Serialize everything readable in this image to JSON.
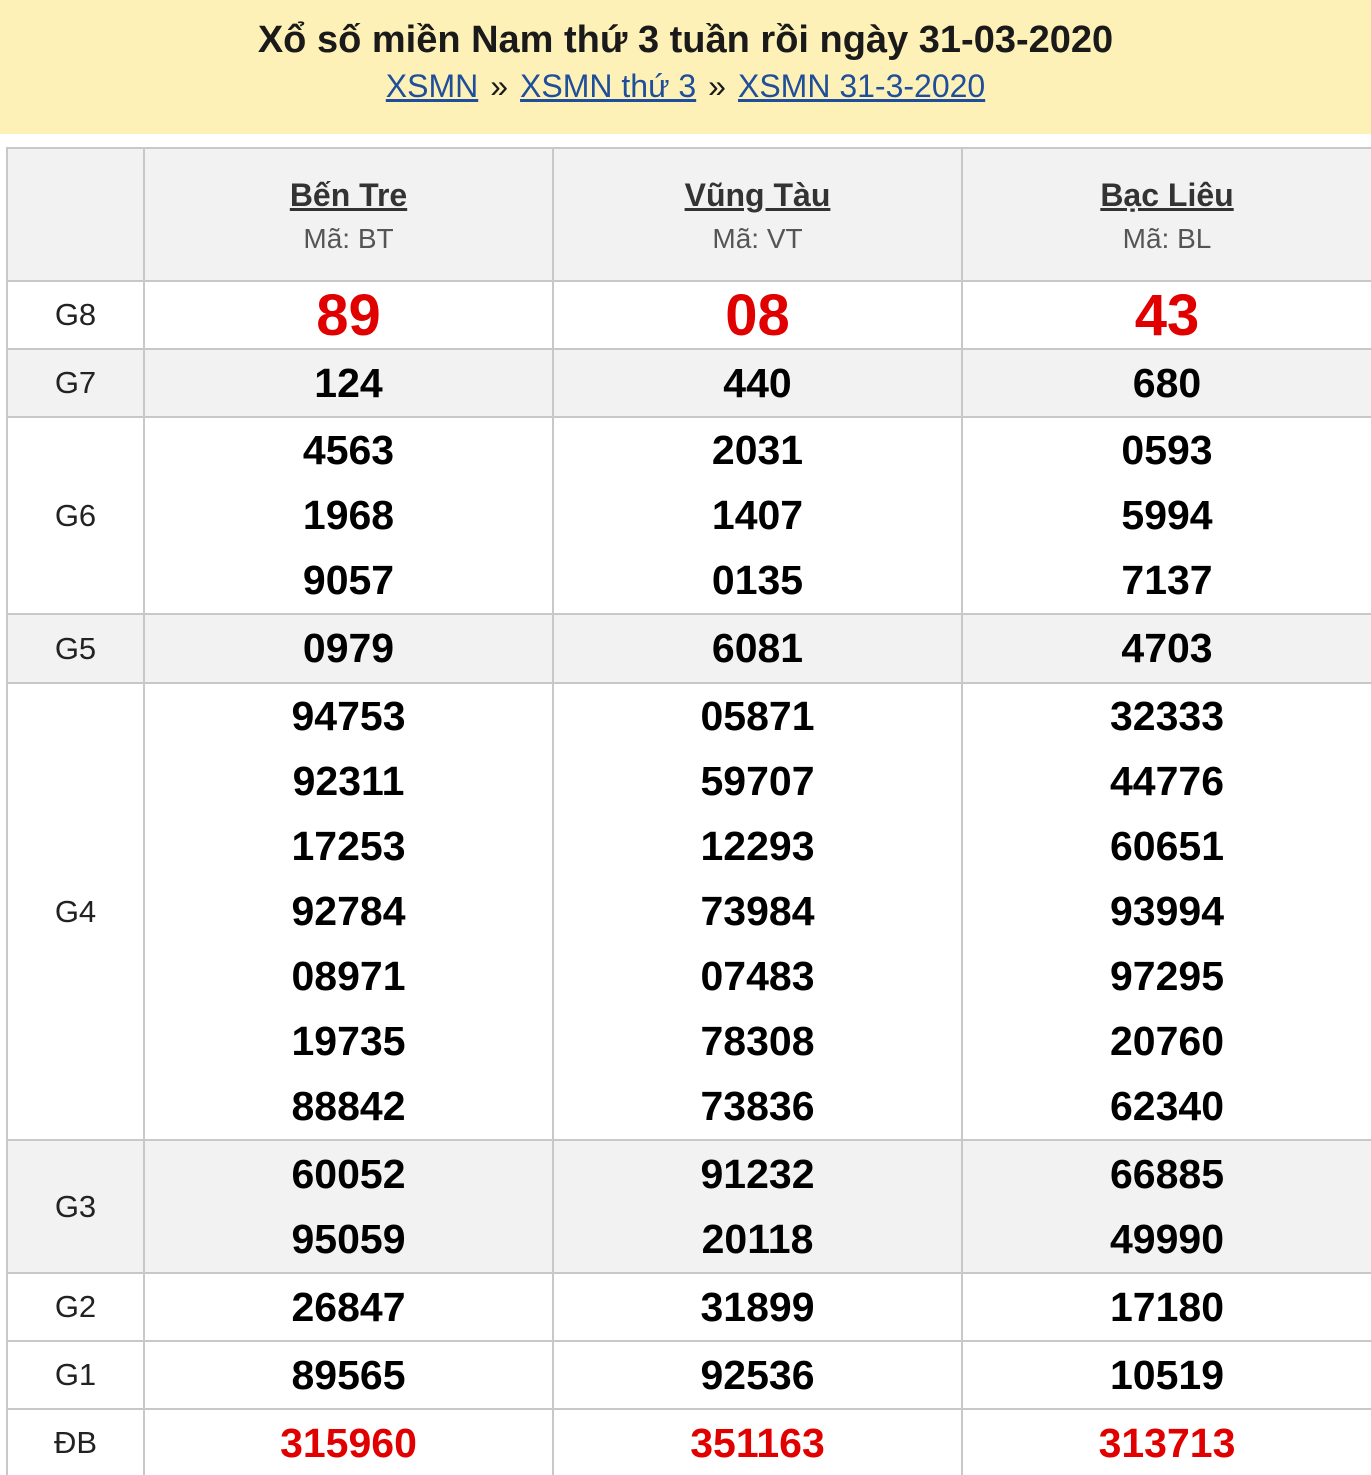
{
  "header": {
    "title": "Xổ số miền Nam thứ 3 tuần rồi ngày 31-03-2020",
    "breadcrumbs": [
      "XSMN",
      "XSMN thứ 3",
      "XSMN 31-3-2020"
    ],
    "separator": "»"
  },
  "provinces": [
    {
      "name": "Bến Tre",
      "code": "Mã: BT"
    },
    {
      "name": "Vũng Tàu",
      "code": "Mã: VT"
    },
    {
      "name": "Bạc Liêu",
      "code": "Mã: BL"
    }
  ],
  "prizes": [
    {
      "label": "G8",
      "results": [
        [
          "89"
        ],
        [
          "08"
        ],
        [
          "43"
        ]
      ]
    },
    {
      "label": "G7",
      "results": [
        [
          "124"
        ],
        [
          "440"
        ],
        [
          "680"
        ]
      ]
    },
    {
      "label": "G6",
      "results": [
        [
          "4563",
          "1968",
          "9057"
        ],
        [
          "2031",
          "1407",
          "0135"
        ],
        [
          "0593",
          "5994",
          "7137"
        ]
      ]
    },
    {
      "label": "G5",
      "results": [
        [
          "0979"
        ],
        [
          "6081"
        ],
        [
          "4703"
        ]
      ]
    },
    {
      "label": "G4",
      "results": [
        [
          "94753",
          "92311",
          "17253",
          "92784",
          "08971",
          "19735",
          "88842"
        ],
        [
          "05871",
          "59707",
          "12293",
          "73984",
          "07483",
          "78308",
          "73836"
        ],
        [
          "32333",
          "44776",
          "60651",
          "93994",
          "97295",
          "20760",
          "62340"
        ]
      ]
    },
    {
      "label": "G3",
      "results": [
        [
          "60052",
          "95059"
        ],
        [
          "91232",
          "20118"
        ],
        [
          "66885",
          "49990"
        ]
      ]
    },
    {
      "label": "G2",
      "results": [
        [
          "26847"
        ],
        [
          "31899"
        ],
        [
          "17180"
        ]
      ]
    },
    {
      "label": "G1",
      "results": [
        [
          "89565"
        ],
        [
          "92536"
        ],
        [
          "10519"
        ]
      ]
    },
    {
      "label": "ĐB",
      "results": [
        [
          "315960"
        ],
        [
          "351163"
        ],
        [
          "313713"
        ]
      ]
    }
  ],
  "colors": {
    "header_bg": "#fdf1b8",
    "special": "#e10000",
    "link": "#1f4e9b"
  }
}
